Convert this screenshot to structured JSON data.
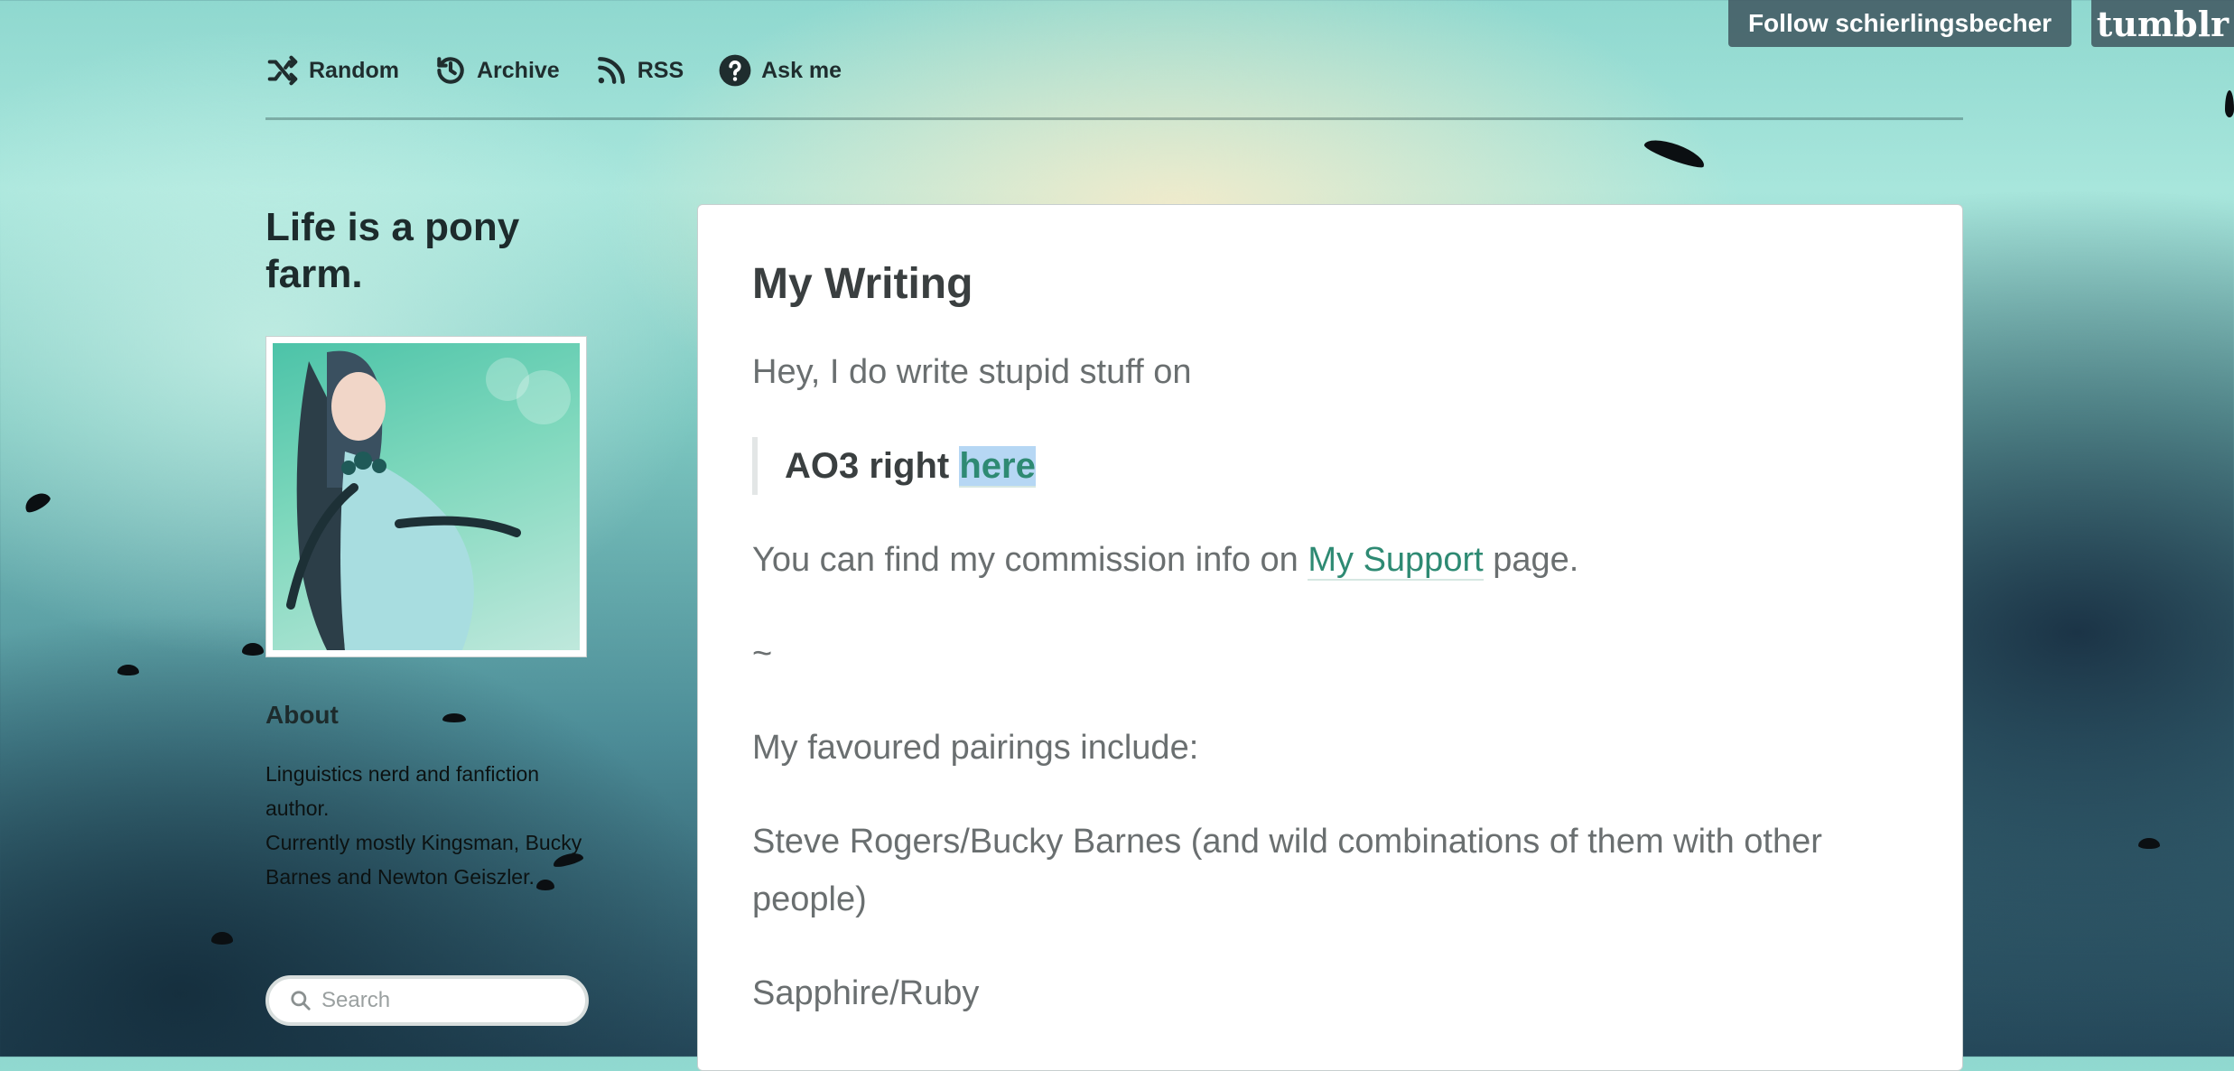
{
  "nav": {
    "items": [
      {
        "label": "Random",
        "icon": "shuffle-icon"
      },
      {
        "label": "Archive",
        "icon": "history-icon"
      },
      {
        "label": "RSS",
        "icon": "rss-icon"
      },
      {
        "label": "Ask me",
        "icon": "question-icon"
      }
    ]
  },
  "header": {
    "follow_label": "Follow schierlingsbecher",
    "tumblr_label": "tumblr"
  },
  "sidebar": {
    "blog_title": "Life is a pony farm.",
    "about_heading": "About",
    "about_lines": [
      "Linguistics nerd and fanfiction author.",
      "Currently mostly Kingsman, Bucky Barnes and Newton Geiszler."
    ],
    "search_placeholder": "Search"
  },
  "post": {
    "title": "My Writing",
    "intro": "Hey, I do write stupid stuff on",
    "quote_text": "AO3 right ",
    "quote_link": "here",
    "commission_before": "You can find my commission info on ",
    "commission_link": "My Support",
    "commission_after": " page.",
    "tilde": "~",
    "pairings_heading": "My favoured pairings include:",
    "pairing_1": "Steve Rogers/Bucky Barnes (and wild combinations of them with other people)",
    "pairing_2": "Sapphire/Ruby"
  },
  "colors": {
    "link": "#2e8a73",
    "highlight": "#b6d7f4",
    "header_bg": "#3c505a"
  }
}
